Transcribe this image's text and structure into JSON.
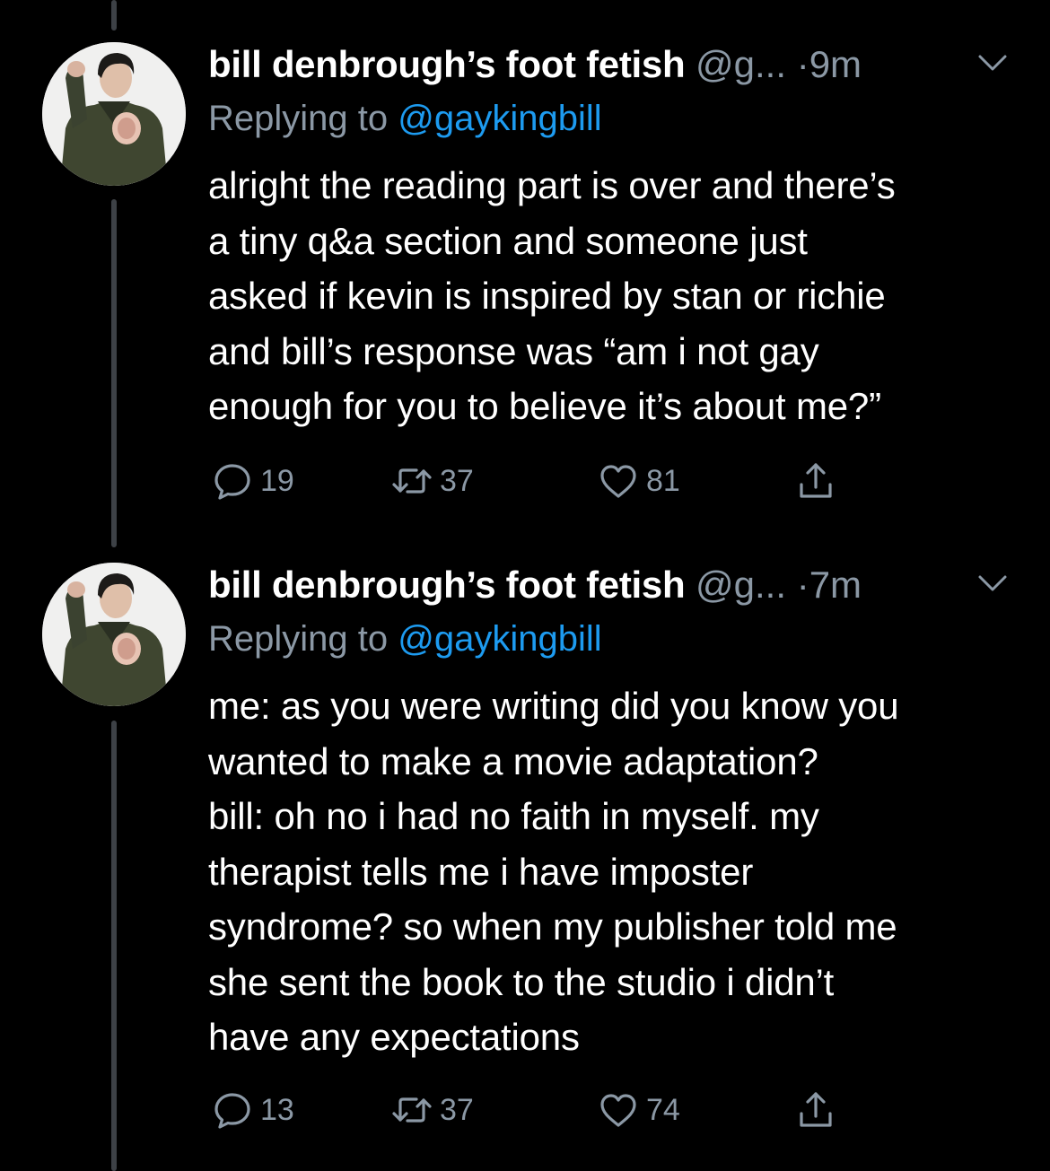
{
  "tweets": [
    {
      "display_name": "bill denbrough’s foot fetish",
      "handle": "@g...",
      "separator": "·",
      "time": "9m",
      "replying_prefix": "Replying to ",
      "replying_to": "@gaykingbill",
      "text_lines": [
        "alright the reading part is over and there’s",
        "a tiny q&a section and someone just",
        "asked if kevin is inspired by stan or richie",
        "and bill’s response was “am i not gay",
        "enough for you to believe it’s about me?”"
      ],
      "replies": "19",
      "retweets": "37",
      "likes": "81"
    },
    {
      "display_name": "bill denbrough’s foot fetish",
      "handle": "@g...",
      "separator": "·",
      "time": "7m",
      "replying_prefix": "Replying to ",
      "replying_to": "@gaykingbill",
      "text_lines": [
        "me: as you were writing did you know you",
        "wanted to make a movie adaptation?",
        "bill: oh no i had no faith in myself. my",
        "therapist tells me i have imposter",
        "syndrome? so when my publisher told me",
        "she sent the book to the studio i didn’t",
        "have any expectations"
      ],
      "replies": "13",
      "retweets": "37",
      "likes": "74"
    }
  ],
  "icons": {
    "reply": "reply-bubble-icon",
    "retweet": "retweet-arrows-icon",
    "like": "heart-icon",
    "share": "share-upload-icon",
    "menu": "chevron-down-icon"
  },
  "colors": {
    "background": "#000000",
    "text": "#ffffff",
    "secondary": "#8b98a5",
    "mention": "#1d9bf0",
    "thread_line": "#3d4146"
  }
}
